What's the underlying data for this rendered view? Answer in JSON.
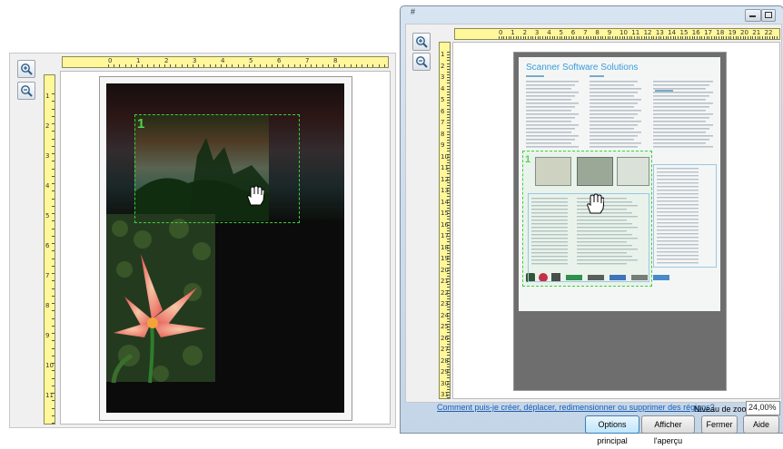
{
  "left_panel": {
    "zoom_in_icon": "zoom-in",
    "zoom_out_icon": "zoom-out",
    "ruler_numbers": [
      "0",
      "1",
      "2",
      "3",
      "4",
      "5",
      "6",
      "7",
      "8"
    ],
    "vruler_numbers": [
      "1",
      "2",
      "3",
      "4",
      "5",
      "6",
      "7",
      "8",
      "9",
      "10",
      "11"
    ],
    "region_number": "1"
  },
  "right_window": {
    "title_glyph": "#",
    "ruler_numbers": [
      "0",
      "1",
      "2",
      "3",
      "4",
      "5",
      "6",
      "7",
      "8",
      "9",
      "10",
      "11",
      "12",
      "13",
      "14",
      "15",
      "16",
      "17",
      "18",
      "19",
      "20",
      "21",
      "22"
    ],
    "vruler_numbers": [
      "1",
      "2",
      "3",
      "4",
      "5",
      "6",
      "7",
      "8",
      "9",
      "10",
      "11",
      "12",
      "13",
      "14",
      "15",
      "16",
      "17",
      "18",
      "19",
      "20",
      "21",
      "22",
      "23",
      "24",
      "25",
      "26",
      "27",
      "28",
      "29",
      "30",
      "31"
    ],
    "doc_title": "Scanner Software Solutions",
    "region_number": "1",
    "help_link": "Comment puis-je créer, déplacer, redimensionner ou supprimer des régions?",
    "zoom_label": "Niveau de zoom :",
    "zoom_value": "24,00%",
    "buttons": {
      "options": "Options principal",
      "preview": "Afficher l'aperçu",
      "close": "Fermer",
      "help": "Aide"
    }
  }
}
